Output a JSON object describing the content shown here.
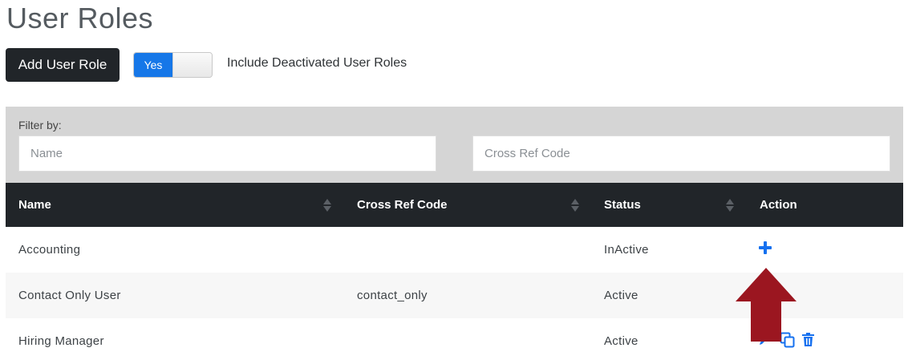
{
  "page": {
    "title": "User Roles"
  },
  "toolbar": {
    "add_label": "Add User Role",
    "toggle_value": "Yes",
    "include_label": "Include Deactivated User Roles"
  },
  "filter": {
    "label": "Filter by:",
    "name_placeholder": "Name",
    "crossref_placeholder": "Cross Ref Code"
  },
  "table": {
    "headers": [
      "Name",
      "Cross Ref Code",
      "Status",
      "Action"
    ],
    "rows": [
      {
        "name": "Accounting",
        "cross_ref": "",
        "status": "InActive",
        "actions": [
          "plus-icon"
        ]
      },
      {
        "name": "Contact Only User",
        "cross_ref": "contact_only",
        "status": "Active",
        "actions": []
      },
      {
        "name": "Hiring Manager",
        "cross_ref": "",
        "status": "Active",
        "actions": [
          "edit-icon",
          "copy-icon",
          "trash-icon"
        ]
      }
    ]
  },
  "colors": {
    "accent": "#1570ef",
    "header_bg": "#212529",
    "filter_bg": "#d5d5d5",
    "arrow": "#9b1620"
  }
}
